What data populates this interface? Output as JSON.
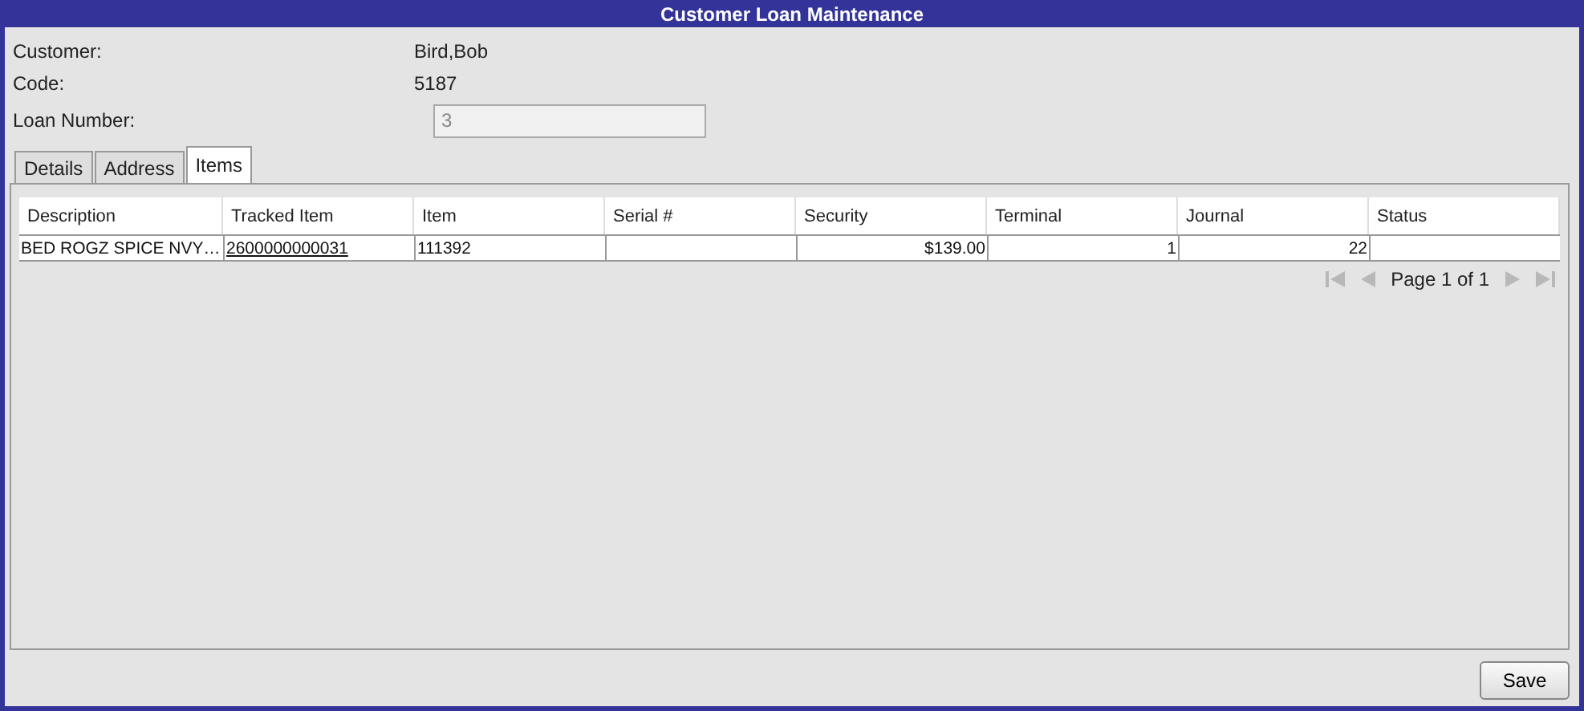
{
  "window": {
    "title": "Customer Loan Maintenance"
  },
  "fields": [
    {
      "label": "Customer:",
      "kind": "text",
      "value": "Bird,Bob"
    },
    {
      "label": "Code:",
      "kind": "text",
      "value": "5187"
    },
    {
      "label": "Loan Number:",
      "kind": "input",
      "value": "3",
      "disabled": true
    }
  ],
  "tabs": [
    {
      "label": "Details",
      "selected": false
    },
    {
      "label": "Address",
      "selected": false
    },
    {
      "label": "Items",
      "selected": true
    }
  ],
  "table": {
    "columns": [
      {
        "label": "Description",
        "kind": "text"
      },
      {
        "label": "Tracked Item",
        "kind": "link"
      },
      {
        "label": "Item",
        "kind": "text"
      },
      {
        "label": "Serial #",
        "kind": "text"
      },
      {
        "label": "Security",
        "kind": "number"
      },
      {
        "label": "Terminal",
        "kind": "number"
      },
      {
        "label": "Journal",
        "kind": "number"
      },
      {
        "label": "Status",
        "kind": "text"
      }
    ],
    "rows": [
      [
        "BED ROGZ SPICE NVY…",
        "2600000000031",
        "111392",
        "",
        "$139.00",
        "1",
        "22",
        ""
      ]
    ]
  },
  "pager": {
    "label": "Page 1 of 1",
    "buttons": [
      {
        "kind": "first",
        "disabled": true
      },
      {
        "kind": "prev",
        "disabled": true
      },
      {
        "kind": "next",
        "disabled": true
      },
      {
        "kind": "last",
        "disabled": true
      }
    ]
  },
  "buttons": [
    {
      "label": "Save"
    }
  ]
}
